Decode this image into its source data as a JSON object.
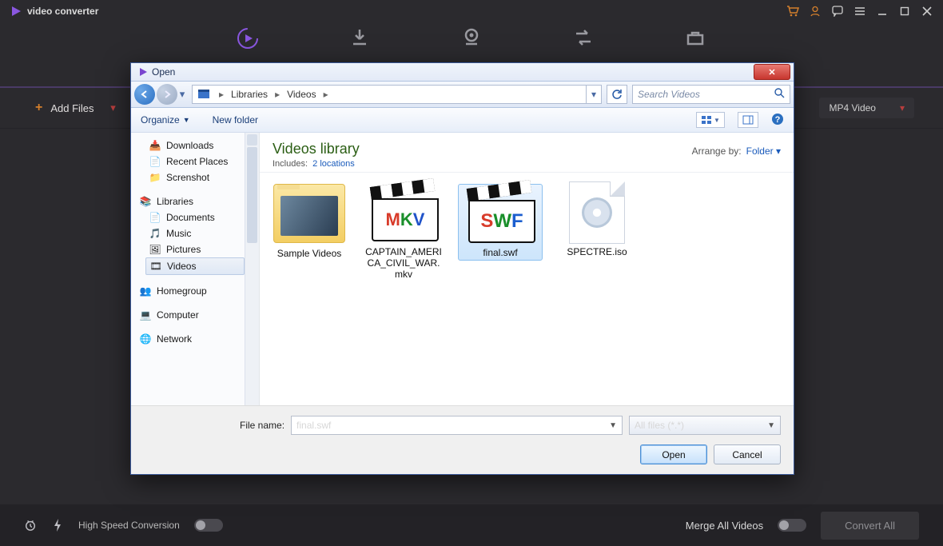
{
  "app": {
    "brand": "video converter",
    "titlebar_icons": [
      "cart-icon",
      "account-icon",
      "chat-icon",
      "menu-icon",
      "minimize-icon",
      "restore-icon",
      "close-icon"
    ],
    "add_files": "Add Files",
    "output_label": "MP4 Video",
    "footer": {
      "high_speed": "High Speed Conversion",
      "merge": "Merge All Videos",
      "convert_all": "Convert All"
    }
  },
  "dialog": {
    "title": "Open",
    "breadcrumb": {
      "seg1": "Libraries",
      "seg2": "Videos"
    },
    "search_placeholder": "Search Videos",
    "toolbar": {
      "organize": "Organize",
      "new_folder": "New folder"
    },
    "library": {
      "title": "Videos library",
      "includes_label": "Includes:",
      "includes_link": "2 locations",
      "arrange_label": "Arrange by:",
      "arrange_value": "Folder"
    },
    "sidebar": {
      "downloads": "Downloads",
      "recent": "Recent Places",
      "screenshot": "Screnshot",
      "libraries": "Libraries",
      "documents": "Documents",
      "music": "Music",
      "pictures": "Pictures",
      "videos": "Videos",
      "homegroup": "Homegroup",
      "computer": "Computer",
      "network": "Network"
    },
    "files": {
      "f0": "Sample Videos",
      "f1": "CAPTAIN_AMERICA_CIVIL_WAR.mkv",
      "f2": "final.swf",
      "f3": "SPECTRE.iso"
    },
    "file_name_label": "File name:",
    "file_name_value": "final.swf",
    "filter": "All files (*.*)",
    "open_btn": "Open",
    "cancel_btn": "Cancel"
  }
}
